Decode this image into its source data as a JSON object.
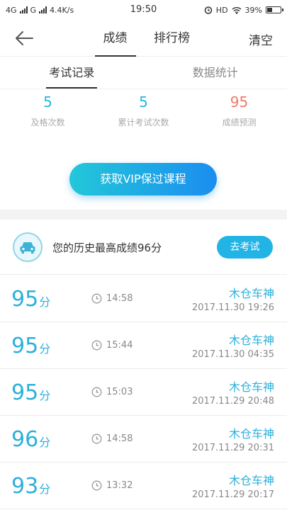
{
  "status": {
    "network_left": "4G",
    "network_mid": "G",
    "speed": "4.4K/s",
    "time": "19:50",
    "hd": "HD",
    "battery": "39%",
    "battery_level": 0.39
  },
  "header": {
    "tabs": [
      {
        "label": "成绩",
        "active": true
      },
      {
        "label": "排行榜",
        "active": false
      }
    ],
    "clear_label": "清空"
  },
  "subtabs": [
    {
      "label": "考试记录",
      "active": true
    },
    {
      "label": "数据统计",
      "active": false
    }
  ],
  "stats": [
    {
      "value": "5",
      "label": "及格次数"
    },
    {
      "value": "5",
      "label": "累计考试次数"
    },
    {
      "value": "95",
      "label": "成绩预测"
    }
  ],
  "vip_button": "获取VIP保过课程",
  "best": {
    "text": "您的历史最高成绩96分",
    "button": "去考试"
  },
  "records": [
    {
      "score": "95",
      "unit": "分",
      "duration": "14:58",
      "rank": "木仓车神",
      "date": "2017.11.30  19:26"
    },
    {
      "score": "95",
      "unit": "分",
      "duration": "15:44",
      "rank": "木仓车神",
      "date": "2017.11.30  04:35"
    },
    {
      "score": "95",
      "unit": "分",
      "duration": "15:03",
      "rank": "木仓车神",
      "date": "2017.11.29  20:48"
    },
    {
      "score": "96",
      "unit": "分",
      "duration": "14:58",
      "rank": "木仓车神",
      "date": "2017.11.29  20:31"
    },
    {
      "score": "93",
      "unit": "分",
      "duration": "13:32",
      "rank": "木仓车神",
      "date": "2017.11.29  20:17"
    }
  ],
  "colors": {
    "accent": "#2bb0dc",
    "prediction": "#f07a6a",
    "button_gradient_start": "#23c7d9",
    "button_gradient_end": "#1a8df0"
  }
}
